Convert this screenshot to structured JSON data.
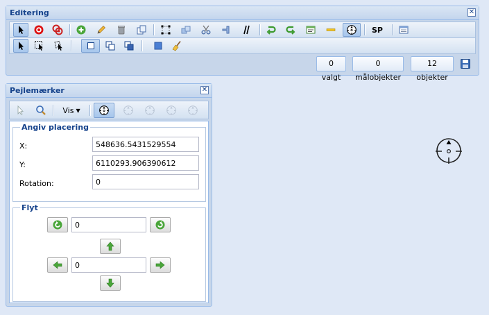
{
  "editing": {
    "title": "Editering",
    "close": "✕",
    "sp_label": "SP",
    "counts": {
      "selected": "0 valgt",
      "target": "0 målobjekter",
      "objects": "12 objekter"
    }
  },
  "bearings": {
    "title": "Pejlemærker",
    "close": "✕",
    "view_label": "Vis",
    "placement": {
      "legend": "Angiv placering",
      "x_label": "X:",
      "x_value": "548636.5431529554",
      "y_label": "Y:",
      "y_value": "6110293.906390612",
      "rotation_label": "Rotation:",
      "rotation_value": "0"
    },
    "move": {
      "legend": "Flyt",
      "rotate_value": "0",
      "shift_value": "0"
    }
  },
  "colors": {
    "accent": "#15428b",
    "panel": "#c7d6ea",
    "background": "#dfe8f6"
  }
}
